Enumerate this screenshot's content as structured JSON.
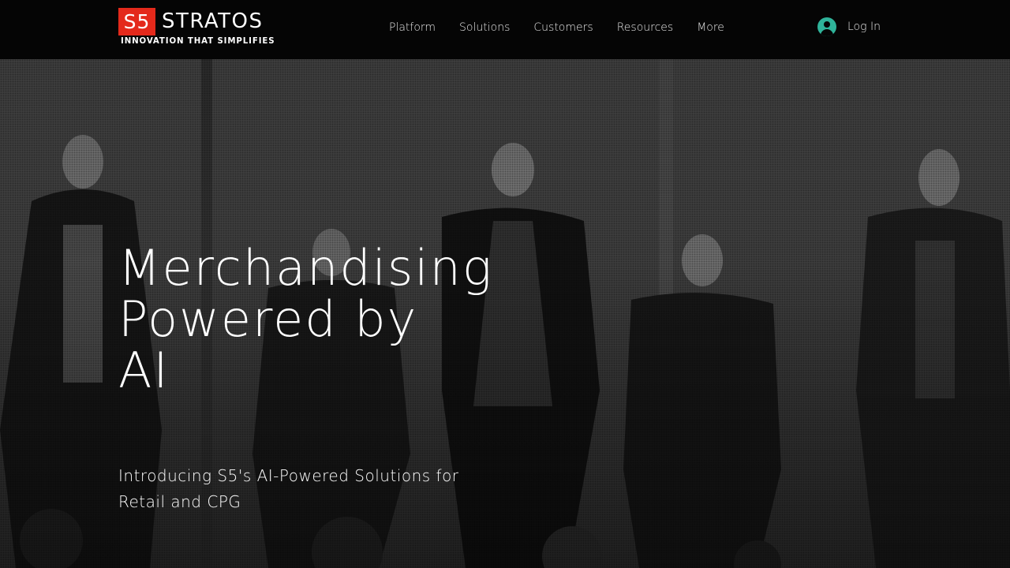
{
  "header": {
    "logo": {
      "mark": "S5",
      "word": "STRATOS",
      "tagline": "INNOVATION THAT SIMPLIFIES"
    },
    "nav": [
      {
        "label": "Platform"
      },
      {
        "label": "Solutions"
      },
      {
        "label": "Customers"
      },
      {
        "label": "Resources"
      },
      {
        "label": "More"
      }
    ],
    "login": {
      "label": "Log In",
      "icon": "user-avatar-icon"
    }
  },
  "hero": {
    "title_lines": [
      "Merchandising",
      "Powered by",
      "AI"
    ],
    "subtitle_lines": [
      "Introducing S5's AI-Powered Solutions for",
      "Retail and CPG"
    ],
    "background": "mannequins-in-store-photo"
  },
  "colors": {
    "logo_red": "#e4291b",
    "login_icon": "#2fb39a",
    "header_bg": "#050505"
  }
}
